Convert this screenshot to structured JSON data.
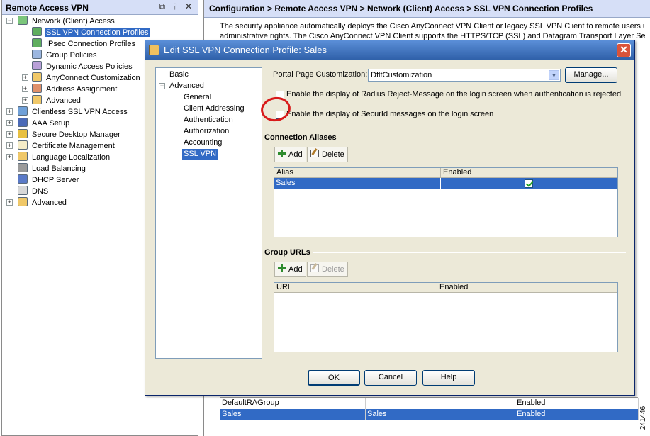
{
  "nav": {
    "title": "Remote Access VPN",
    "controls": [
      "⧉",
      "⫯",
      "✕"
    ],
    "items": [
      {
        "label": "Network (Client) Access",
        "icon": "network-access-icon"
      },
      {
        "label": "SSL VPN Connection Profiles",
        "icon": "connection-profiles-icon"
      },
      {
        "label": "IPsec Connection Profiles",
        "icon": "connection-profiles-icon"
      },
      {
        "label": "Group Policies",
        "icon": "group-policies-icon"
      },
      {
        "label": "Dynamic Access Policies",
        "icon": "dynamic-access-icon"
      },
      {
        "label": "AnyConnect Customization",
        "icon": "customization-icon"
      },
      {
        "label": "Address Assignment",
        "icon": "address-assignment-icon"
      },
      {
        "label": "Advanced",
        "icon": "advanced-icon"
      },
      {
        "label": "Clientless SSL VPN Access",
        "icon": "clientless-icon"
      },
      {
        "label": "AAA Setup",
        "icon": "aaa-icon"
      },
      {
        "label": "Secure Desktop Manager",
        "icon": "lock-icon"
      },
      {
        "label": "Certificate Management",
        "icon": "certificate-icon"
      },
      {
        "label": "Language Localization",
        "icon": "language-icon"
      },
      {
        "label": "Load Balancing",
        "icon": "load-balancing-icon"
      },
      {
        "label": "DHCP Server",
        "icon": "dhcp-icon"
      },
      {
        "label": "DNS",
        "icon": "dns-icon"
      },
      {
        "label": "Advanced",
        "icon": "advanced-icon"
      }
    ]
  },
  "content": {
    "breadcrumb": "Configuration > Remote Access VPN > Network (Client) Access > SSL VPN Connection Profiles",
    "description_line1": "The security appliance automatically deploys the Cisco AnyConnect VPN Client or legacy SSL VPN Client to remote users upo",
    "description_line2": "administrative rights. The Cisco AnyConnect VPN Client supports the HTTPS/TCP (SSL) and Datagram Transport Layer Secu",
    "profiles_rows": [
      {
        "name": "DefaultRAGroup",
        "aliases": "",
        "enabled": "Enabled"
      },
      {
        "name": "Sales",
        "aliases": "Sales",
        "enabled": "Enabled"
      }
    ]
  },
  "dialog": {
    "title": "Edit SSL VPN Connection Profile: Sales",
    "close_label": "✕",
    "nav_items": [
      "Basic",
      "Advanced",
      "General",
      "Client Addressing",
      "Authentication",
      "Authorization",
      "Accounting",
      "SSL VPN"
    ],
    "portal_label": "Portal Page Customization:",
    "portal_value": "DfltCustomization",
    "manage_label": "Manage...",
    "radius_checkbox_label": "Enable the display of Radius Reject-Message on the login screen when authentication is rejected",
    "securid_checkbox_label": "Enable the display of SecurId messages on the login screen",
    "connection_aliases": {
      "title": "Connection Aliases",
      "add_label": "Add",
      "delete_label": "Delete",
      "columns": [
        "Alias",
        "Enabled"
      ],
      "rows": [
        {
          "alias": "Sales",
          "enabled": true
        }
      ]
    },
    "group_urls": {
      "title": "Group URLs",
      "add_label": "Add",
      "delete_label": "Delete",
      "columns": [
        "URL",
        "Enabled"
      ],
      "rows": []
    },
    "ok_label": "OK",
    "cancel_label": "Cancel",
    "help_label": "Help"
  },
  "figure_number": "241446",
  "colors": {
    "selection": "#316ac5",
    "header_bg": "#d6dff7",
    "dialog_bg": "#ece9d8",
    "titlebar": "#2e5fa8",
    "highlight_circle": "#d81a1a"
  }
}
